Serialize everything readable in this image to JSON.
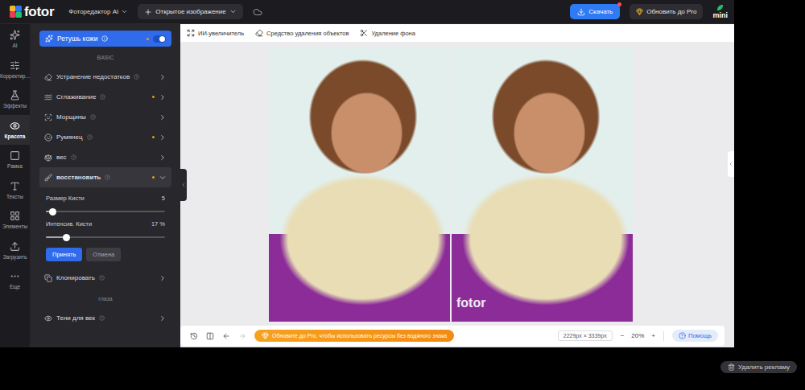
{
  "topbar": {
    "logo": "fotor",
    "menu": "Фоторедактор AI",
    "open_button": "Открытое изображение",
    "download": "Скачать",
    "upgrade": "Обновить до Pro",
    "mini": "mini"
  },
  "rail": [
    {
      "label": "AI",
      "selected": false
    },
    {
      "label": "Корректир...",
      "selected": false
    },
    {
      "label": "Эффекты",
      "selected": false
    },
    {
      "label": "Красота",
      "selected": true
    },
    {
      "label": "Рамка",
      "selected": false
    },
    {
      "label": "Тексты",
      "selected": false
    },
    {
      "label": "Элементы",
      "selected": false
    },
    {
      "label": "Загрузить",
      "selected": false
    },
    {
      "label": "Еще",
      "selected": false
    }
  ],
  "panel": {
    "header": {
      "label": "Ретушь кожи",
      "on": true,
      "dot": true
    },
    "sections": [
      {
        "title": "BASIC",
        "items": [
          {
            "label": "Устранение недостатков",
            "dot": false,
            "expanded": false
          },
          {
            "label": "Сглаживание",
            "dot": true,
            "expanded": false
          },
          {
            "label": "Морщины",
            "dot": false,
            "expanded": false
          },
          {
            "label": "Румянец",
            "dot": true,
            "expanded": false
          },
          {
            "label": "вес",
            "dot": false,
            "expanded": false
          },
          {
            "label": "восстановить",
            "dot": true,
            "expanded": true,
            "controls": {
              "sliders": [
                {
                  "label": "Размер Кисти",
                  "reading": "5",
                  "level": 0.06
                },
                {
                  "label": "Интенсив. Кисти",
                  "reading": "17 %",
                  "level": 0.17
                }
              ],
              "buttons": [
                {
                  "label": "Принять",
                  "kind": "primary"
                },
                {
                  "label": "Отмена",
                  "kind": "secondary"
                }
              ]
            }
          },
          {
            "label": "Клонировать",
            "dot": false,
            "expanded": false
          }
        ]
      },
      {
        "title": "глаза",
        "items": [
          {
            "label": "Тени для век",
            "dot": false,
            "expanded": false
          }
        ]
      }
    ]
  },
  "toolbar": [
    "ИИ-увеличитель",
    "Средство удаления объектов",
    "Удаление фона"
  ],
  "canvas": {
    "watermark": "fotor"
  },
  "bottom_bar": {
    "undo_enabled": true,
    "redo_enabled": false,
    "banner": "Обновите до Pro, чтобы использовать ресурсы без водяного знака",
    "dimensions": "2229px × 3339px",
    "zoom_out": "−",
    "zoom": "20%",
    "zoom_in": "+",
    "help": "Помощь"
  },
  "ad": {
    "label": "Удалить рекламу"
  }
}
